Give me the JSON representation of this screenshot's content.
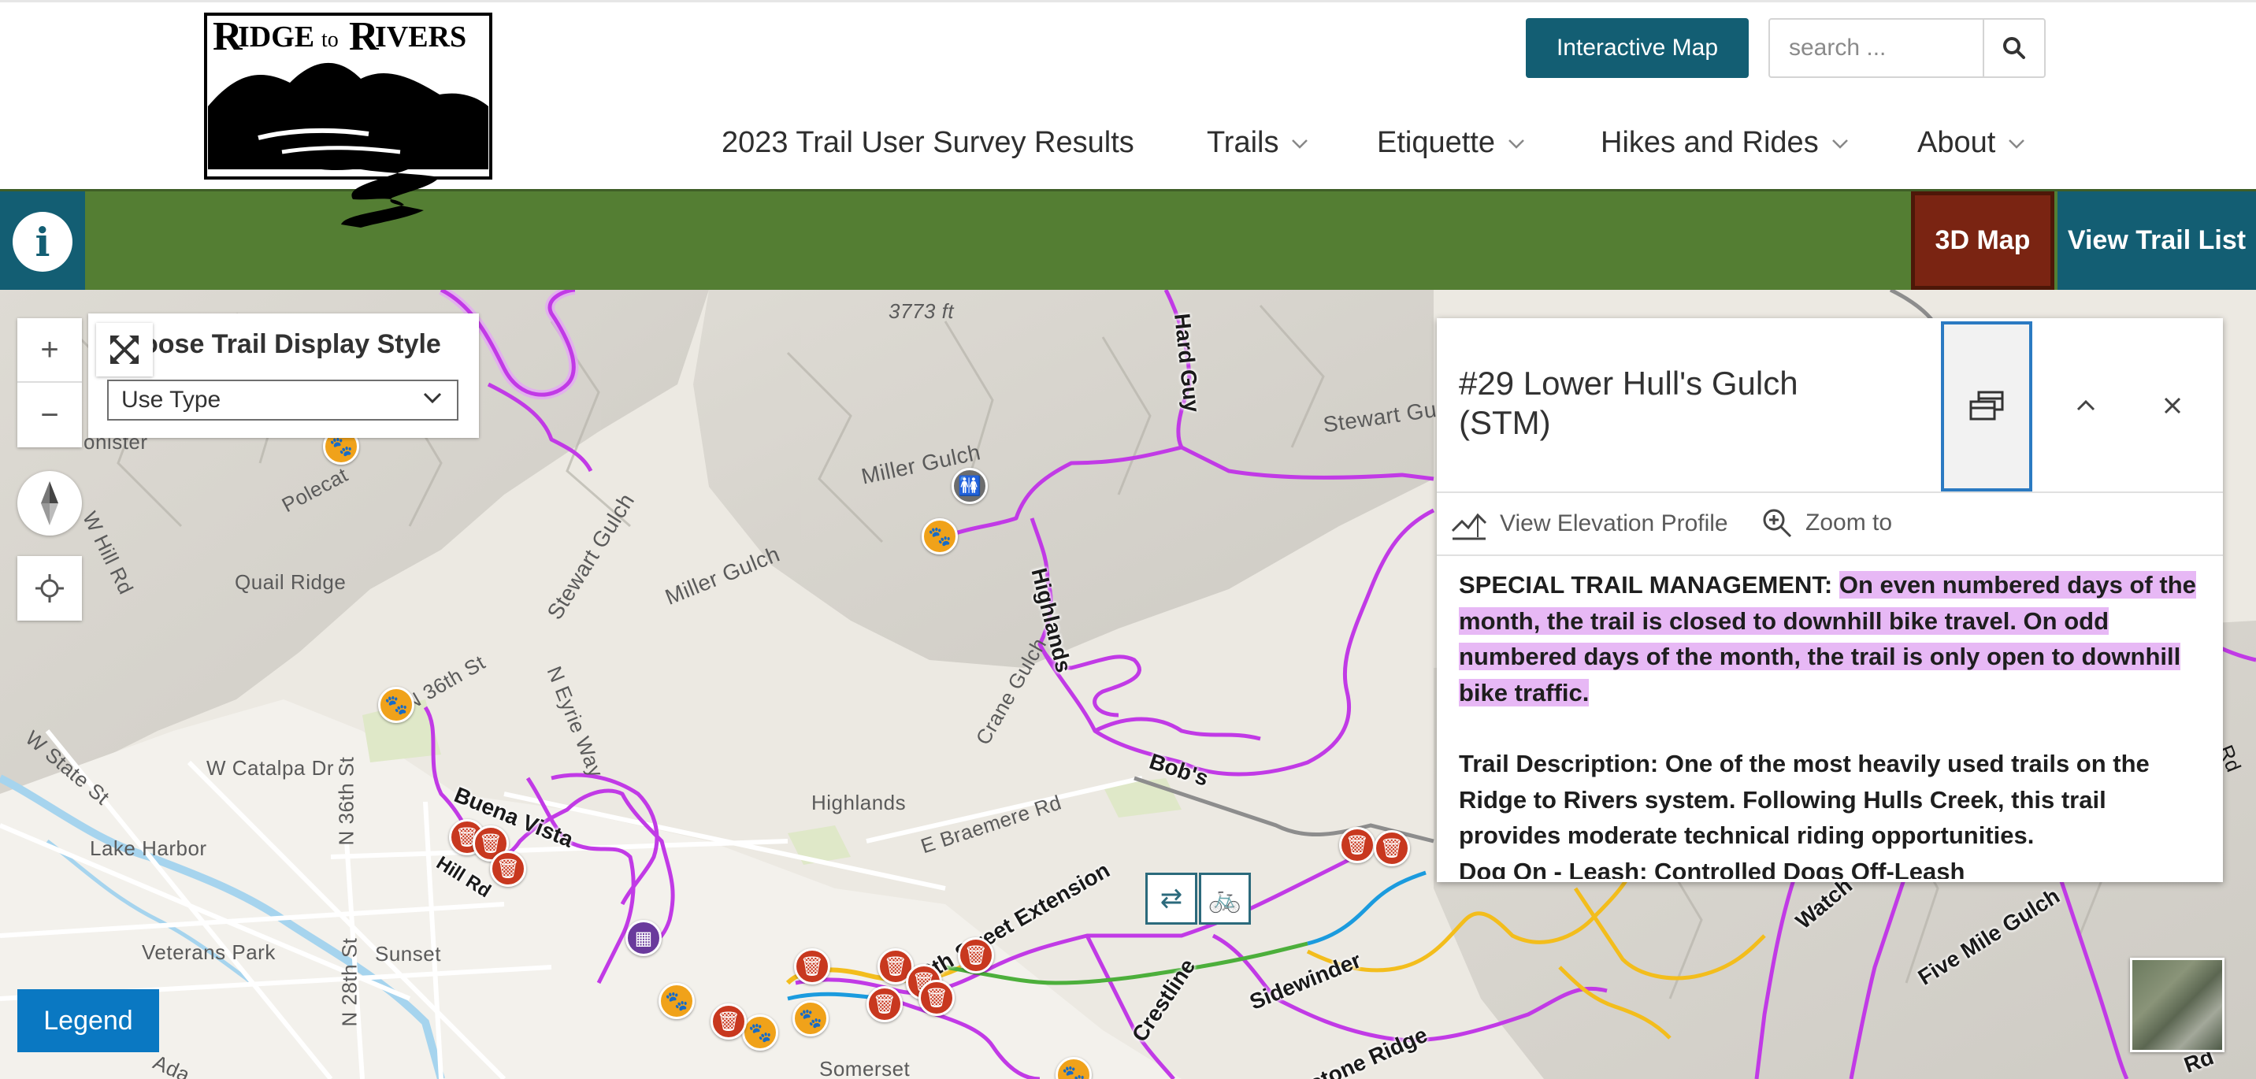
{
  "header": {
    "logo_text": "RIDGE to RIVERS",
    "interactive_map_label": "Interactive Map",
    "search": {
      "placeholder": "search ..."
    },
    "nav": [
      {
        "label": "2023 Trail User Survey Results",
        "has_dropdown": false
      },
      {
        "label": "Trails",
        "has_dropdown": true
      },
      {
        "label": "Etiquette",
        "has_dropdown": true
      },
      {
        "label": "Hikes and Rides",
        "has_dropdown": true
      },
      {
        "label": "About",
        "has_dropdown": true
      }
    ]
  },
  "toolbar": {
    "info_icon": "info-icon",
    "map3d_label": "3D Map",
    "trail_list_label": "View Trail List"
  },
  "map": {
    "display_style": {
      "title": "Choose Trail Display Style",
      "visible_title": "oose Trail Display Style",
      "selected": "Use Type"
    },
    "legend_label": "Legend",
    "place_labels": [
      "3773 ft",
      "Miller Gulch",
      "Miller Gulch",
      "Stewart Gulch",
      "Stewart Gulch",
      "Quail Ridge",
      "W Hill Rd",
      "N 36th St",
      "N Eyrie Way",
      "W State St",
      "W Catalpa Dr",
      "Lake Harbor",
      "Highlands",
      "E Braemere Rd",
      "Crane Gulch",
      "Veterans Park",
      "Sunset",
      "N 36th St",
      "N 28th St",
      "Somerset",
      "Polecat",
      "onister",
      "Ada",
      "Rd",
      "Rd",
      "Watch",
      "Five Mile Gulch"
    ],
    "trail_labels": [
      "Hard Guy",
      "Highlands",
      "Bob's",
      "Buena Vista",
      "8th Street Extension",
      "Crestline",
      "Sidewinder",
      "estone Ridge",
      "Hill Rd"
    ],
    "trail_colors": {
      "multi_use": "#c13ae6",
      "hike_only": "#1b9bde",
      "directional": "#f3bd1c",
      "bike": "#4caf3b",
      "road": "#8d8d8d"
    }
  },
  "popup": {
    "title": "#29 Lower Hull's Gulch (STM)",
    "actions": {
      "elevation": "View Elevation Profile",
      "zoom": "Zoom to"
    },
    "special_label": "SPECIAL TRAIL MANAGEMENT:",
    "special_text": "On even numbered days of the month, the trail is closed to downhill bike travel. On odd numbered days of the month, the trail is only open to downhill bike traffic.",
    "description": "Trail Description: One of the most heavily used trails on the Ridge to Rivers system. Following Hulls Creek, this trail provides moderate technical riding opportunities.",
    "dog_policy": "Dog On - Leash: Controlled Dogs Off-Leash"
  }
}
